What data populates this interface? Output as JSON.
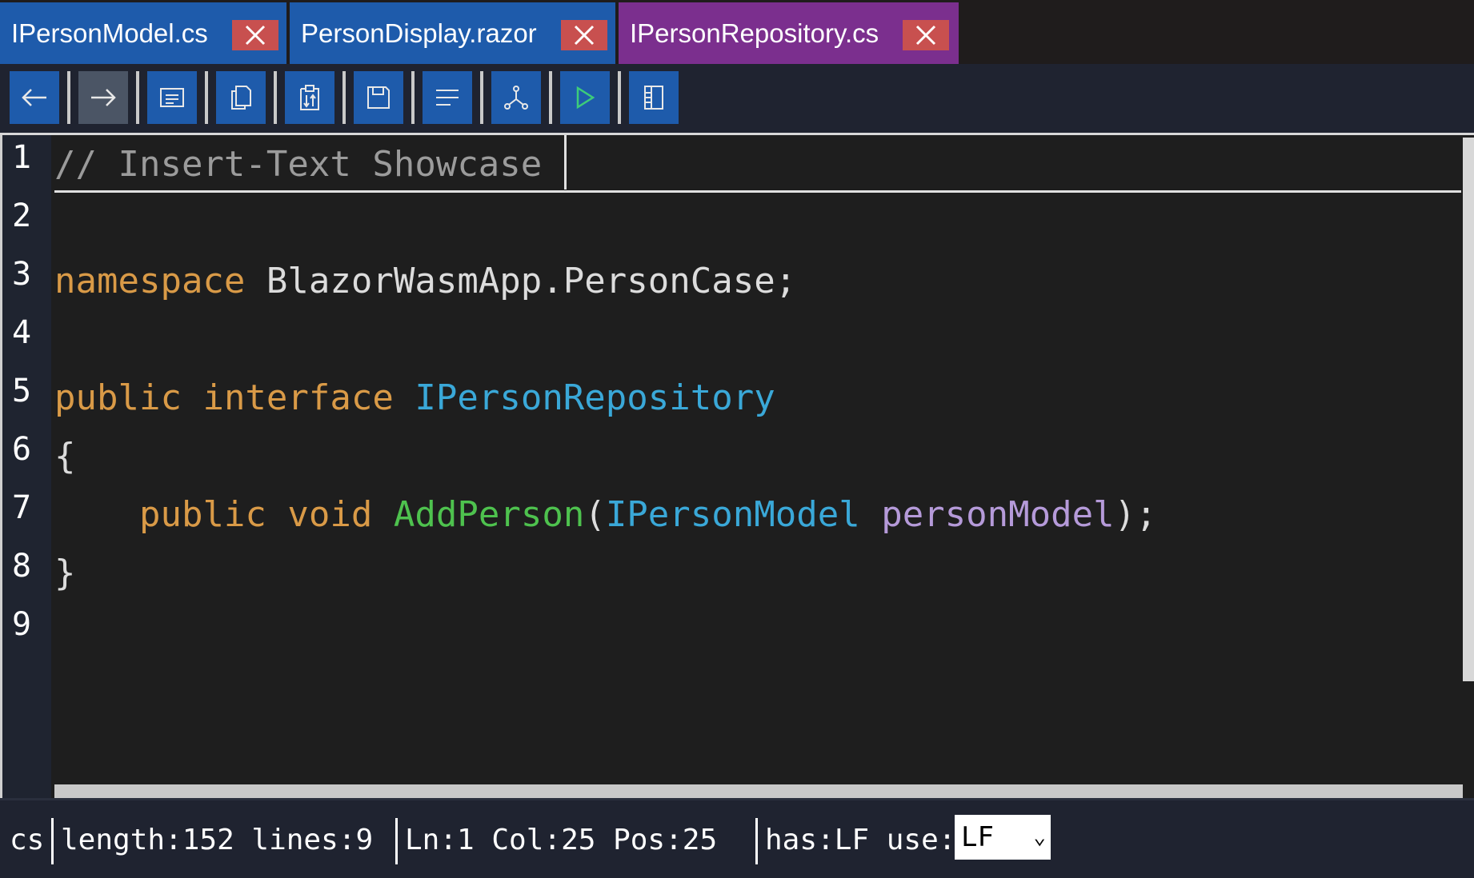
{
  "tabs": [
    {
      "label": "IPersonModel.cs",
      "bg": "#1e5bab",
      "active": false
    },
    {
      "label": "PersonDisplay.razor",
      "bg": "#1e5bab",
      "active": false
    },
    {
      "label": "IPersonRepository.cs",
      "bg": "#7b2f8e",
      "active": true
    }
  ],
  "toolbar": {
    "buttons": [
      {
        "icon": "arrow-left-icon"
      },
      {
        "icon": "arrow-right-icon",
        "active": true
      },
      {
        "icon": "document-text-icon"
      },
      {
        "icon": "copy-icon"
      },
      {
        "icon": "paste-icon"
      },
      {
        "icon": "save-icon"
      },
      {
        "icon": "align-left-icon"
      },
      {
        "icon": "syntax-tree-icon"
      },
      {
        "icon": "run-icon"
      },
      {
        "icon": "panel-icon"
      }
    ]
  },
  "editor": {
    "line_numbers": [
      "1",
      "2",
      "3",
      "4",
      "5",
      "6",
      "7",
      "8",
      "9"
    ],
    "lines": {
      "l1": {
        "comment": "// Insert-Text Showcase"
      },
      "l3": {
        "kw": "namespace",
        "rest": " BlazorWasmApp.PersonCase;"
      },
      "l5": {
        "kw1": "public",
        "kw2": "interface",
        "type": "IPersonRepository"
      },
      "l6": {
        "text": "{"
      },
      "l7": {
        "indent": "    ",
        "kw1": "public",
        "kw2": "void",
        "method": "AddPerson",
        "open": "(",
        "type": "IPersonModel",
        "param": "personModel",
        "close": ");"
      },
      "l8": {
        "text": "}"
      }
    }
  },
  "status": {
    "language": "cs",
    "length": "length:152 lines:9",
    "position": "Ln:1 Col:25 Pos:25",
    "has": "has:LF use:",
    "eol_selected": "LF"
  },
  "colors": {
    "keyword": "#d99a47",
    "type": "#3aa8d8",
    "method": "#4ec24e",
    "parameter": "#b59ad9",
    "comment": "#9b9b9b",
    "tab_close": "#c8504f"
  }
}
